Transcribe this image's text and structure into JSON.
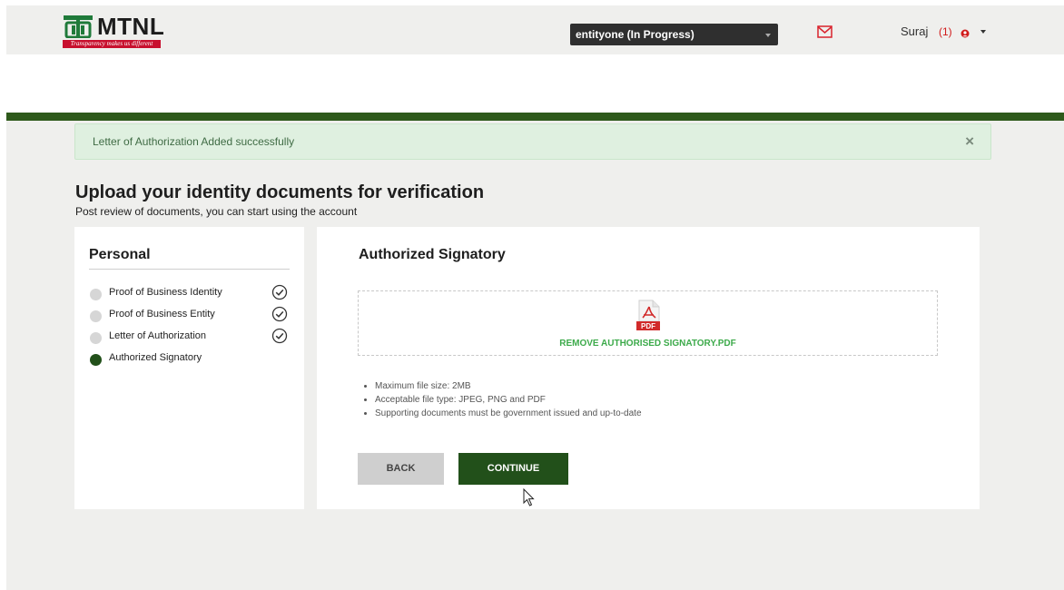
{
  "header": {
    "brand": "MTNL",
    "tagline": "Transparency makes us different",
    "entity_select": "entityone (In Progress)",
    "user_name": "Suraj",
    "user_count": "(1)"
  },
  "alert": {
    "message": "Letter of Authorization Added successfully",
    "close": "×"
  },
  "page": {
    "title": "Upload your identity documents for verification",
    "subtitle": "Post review of documents, you can start using the account"
  },
  "sidebar": {
    "heading": "Personal",
    "steps": [
      {
        "label": "Proof of Business Identity",
        "completed": true
      },
      {
        "label": "Proof of Business Entity",
        "completed": true
      },
      {
        "label": "Letter of Authorization",
        "completed": true
      },
      {
        "label": "Authorized Signatory",
        "completed": false,
        "active": true
      }
    ]
  },
  "main": {
    "heading": "Authorized Signatory",
    "pdf_badge": "PDF",
    "file_link": "REMOVE AUTHORISED SIGNATORY.PDF",
    "rules": [
      "Maximum file size: 2MB",
      "Acceptable file type: JPEG, PNG and PDF",
      "Supporting documents must be government issued and up-to-date"
    ],
    "back_label": "BACK",
    "continue_label": "CONTINUE"
  },
  "colors": {
    "brand_green": "#22501a",
    "success_bg": "#dff0e0",
    "link_green": "#3caa4a",
    "brand_red": "#c8102e"
  }
}
